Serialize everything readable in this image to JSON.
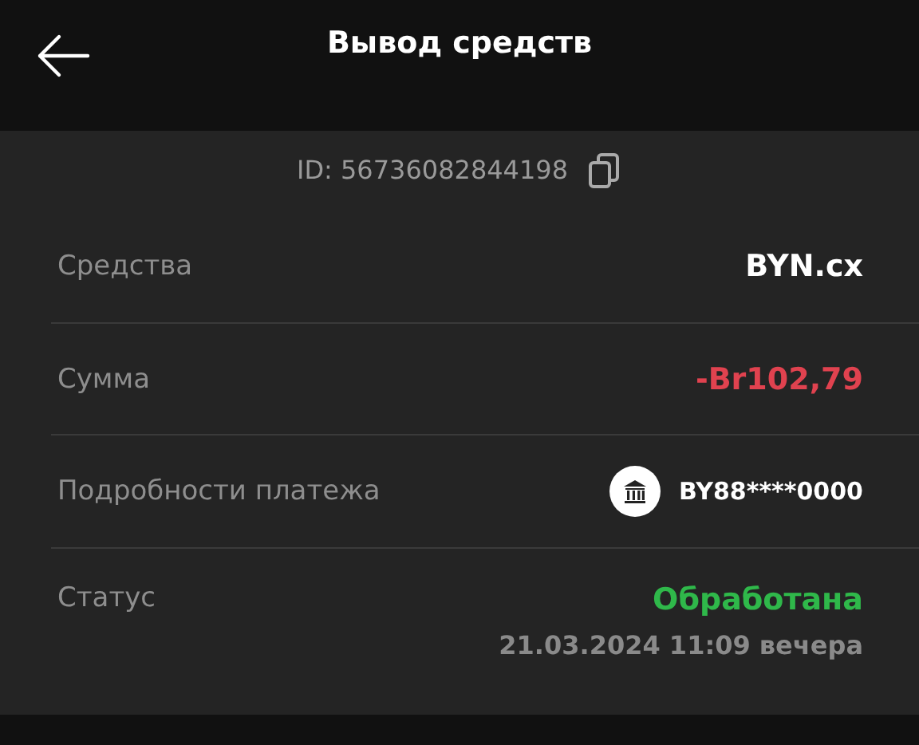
{
  "header": {
    "title": "Вывод средств"
  },
  "transaction_id": "ID: 56736082844198",
  "details": [
    {
      "label": "Средства",
      "kind": "plain",
      "value": "BYN.cx"
    },
    {
      "label": "Сумма",
      "kind": "negative",
      "value": "-Br102,79"
    },
    {
      "label": "Подробности платежа",
      "kind": "bank",
      "value": "BY88****0000"
    },
    {
      "label": "Статус",
      "kind": "status",
      "value": "Обработана",
      "date": "21.03.2024 11:09 вечера"
    }
  ]
}
